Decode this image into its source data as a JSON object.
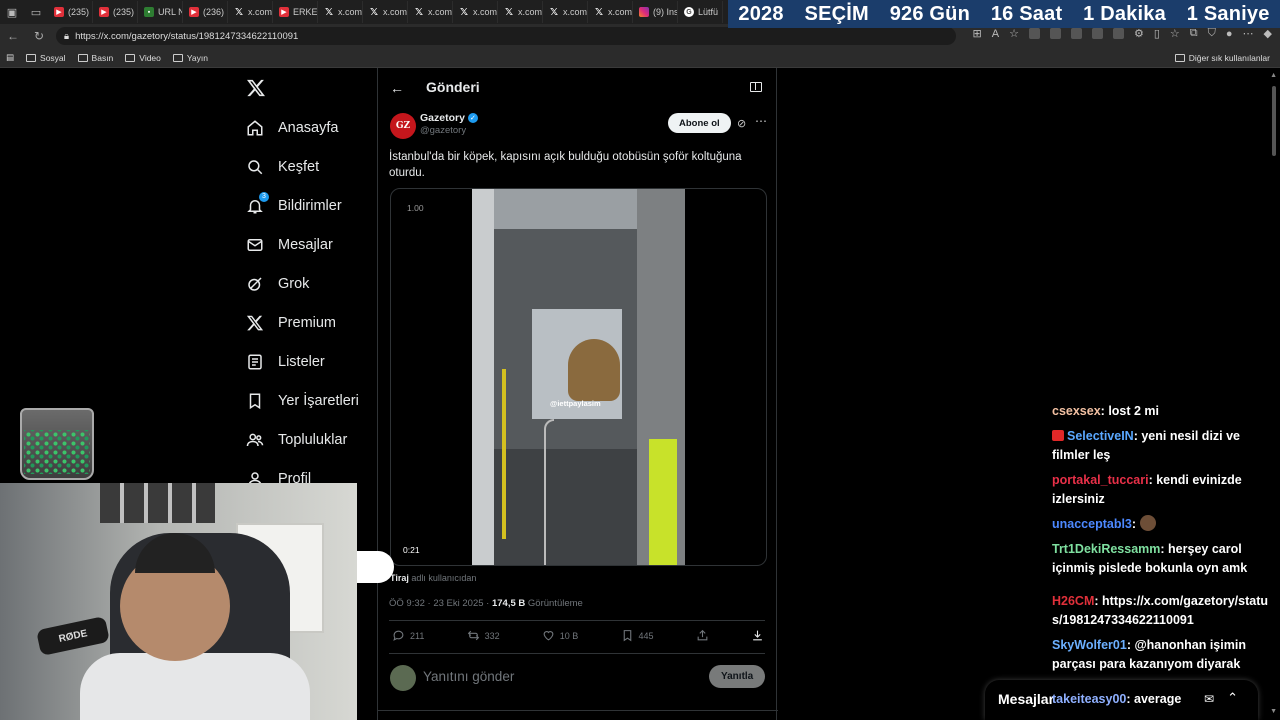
{
  "browser": {
    "tabs": [
      {
        "icon": "youtube-icon",
        "label": "(235)"
      },
      {
        "icon": "youtube-icon",
        "label": "(235)"
      },
      {
        "icon": "url-icon",
        "label": "URL N"
      },
      {
        "icon": "youtube-icon",
        "label": "(236)"
      },
      {
        "icon": "x-icon",
        "label": "x.com"
      },
      {
        "icon": "youtube-icon",
        "label": "ERKEK"
      },
      {
        "icon": "x-icon",
        "label": "x.com"
      },
      {
        "icon": "x-icon",
        "label": "x.com"
      },
      {
        "icon": "x-icon",
        "label": "x.com"
      },
      {
        "icon": "x-icon",
        "label": "x.com"
      },
      {
        "icon": "x-icon",
        "label": "x.com"
      },
      {
        "icon": "x-icon",
        "label": "x.com"
      },
      {
        "icon": "x-icon",
        "label": "x.com"
      },
      {
        "icon": "instagram-icon",
        "label": "(9) Ins"
      },
      {
        "icon": "google-icon",
        "label": "Lütfü"
      }
    ],
    "url": "https://x.com/gazetory/status/1981247334622110091",
    "bookmarks": [
      "Sosyal",
      "Basın",
      "Video",
      "Yayın"
    ],
    "other_bookmarks": "Diğer sık kullanılanlar"
  },
  "countdown": {
    "year": "2028",
    "label": "SEÇİM",
    "days": "926 Gün",
    "hours": "16 Saat",
    "minutes": "1 Dakika",
    "seconds": "1 Saniye",
    "bg_color": "#1b3d6b"
  },
  "sidebar": {
    "items": [
      {
        "label": "Anasayfa",
        "icon": "home-icon"
      },
      {
        "label": "Keşfet",
        "icon": "search-icon"
      },
      {
        "label": "Bildirimler",
        "icon": "bell-icon",
        "badge": "3"
      },
      {
        "label": "Mesajlar",
        "icon": "mail-icon"
      },
      {
        "label": "Grok",
        "icon": "grok-icon"
      },
      {
        "label": "Premium",
        "icon": "x-icon"
      },
      {
        "label": "Listeler",
        "icon": "list-icon"
      },
      {
        "label": "Yer İşaretleri",
        "icon": "bookmark-icon"
      },
      {
        "label": "Topluluklar",
        "icon": "people-icon"
      },
      {
        "label": "Profil",
        "icon": "person-icon"
      }
    ]
  },
  "post": {
    "header_title": "Gönderi",
    "avatar_text": "GZ",
    "author_name": "Gazetory",
    "author_handle": "@gazetory",
    "follow_label": "Abone ol",
    "text": "İstanbul'da bir köpek, kapısını açık bulduğu otobüsün şoför koltuğuna oturdu.",
    "video": {
      "speed": "1.00",
      "duration": "0:21",
      "watermark": "@iettpaylasim"
    },
    "tiraj_name": "Tiraj",
    "tiraj_suffix": "adlı kullanıcıdan",
    "timestamp": "ÖÖ 9:32 · 23 Eki 2025 · ",
    "views_count": "174,5 B",
    "views_label": "Görüntüleme",
    "stats": {
      "replies": "211",
      "reposts": "332",
      "likes": "10 B",
      "bookmarks": "445"
    },
    "reply_placeholder": "Yanıtını gönder",
    "reply_button": "Yanıtla",
    "accent_color": "#1d9bf0"
  },
  "chat": {
    "messages": [
      {
        "user": "csexsex",
        "text": "lost 2 mi"
      },
      {
        "user": "SelectiveIN",
        "text": "yeni nesil dizi ve filmler leş"
      },
      {
        "user": "portakal_tuccari",
        "text": "kendi evinizde izlersiniz"
      },
      {
        "user": "unacceptabl3",
        "text": ""
      },
      {
        "user": "Trt1DekiRessamm",
        "text": "herşey carol içinmiş pislede bokunla oyn amk"
      },
      {
        "user": "H26CM",
        "text": "https://x.com/gazetory/status/1981247334622110091"
      },
      {
        "user": "SkyWolfer01",
        "text": "@hanonhan işimin parçası para kazanıyom diyarak"
      },
      {
        "user": "takeiteasy00",
        "text": "average"
      }
    ]
  },
  "dm_dock": {
    "title": "Mesajlar"
  }
}
